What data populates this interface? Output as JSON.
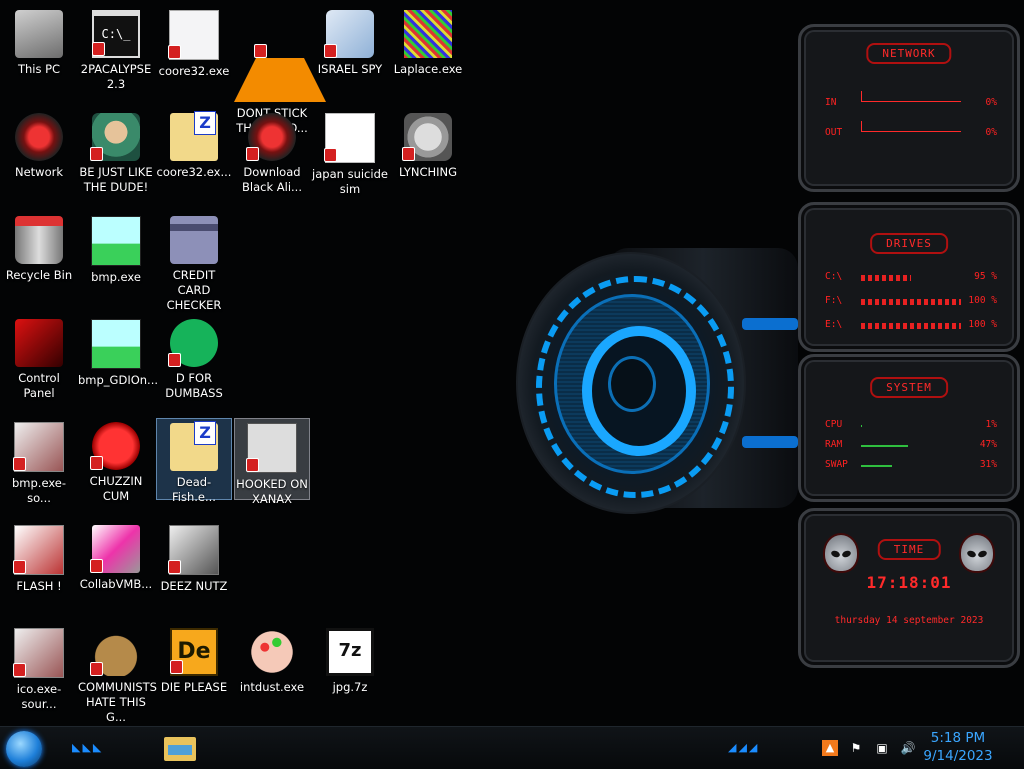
{
  "desktop_icons": [
    {
      "id": "this-pc",
      "label": "This PC",
      "img": "thispc",
      "shield": false
    },
    {
      "id": "2pacalypse",
      "label": "2PACALYPSE 2.3",
      "img": "cmd",
      "glyph": "C:\\_",
      "shield": true
    },
    {
      "id": "coore32-exe",
      "label": "coore32.exe",
      "img": "anime",
      "shield": true
    },
    {
      "id": "dont-stick",
      "label": "DONT STICK THIS IN YO...",
      "img": "vlc",
      "shield": true
    },
    {
      "id": "israel-spy",
      "label": "ISRAEL SPY",
      "img": "israel",
      "shield": true
    },
    {
      "id": "laplace",
      "label": "Laplace.exe",
      "img": "laplace",
      "shield": false
    },
    {
      "id": "network",
      "label": "Network",
      "img": "alien",
      "shield": false
    },
    {
      "id": "be-just-like",
      "label": "BE JUST LIKE THE DUDE!",
      "img": "dude",
      "shield": true
    },
    {
      "id": "coore32-zip",
      "label": "coore32.ex...",
      "img": "zip",
      "shield": false
    },
    {
      "id": "download-black",
      "label": "Download Black Ali...",
      "img": "alien",
      "shield": true
    },
    {
      "id": "japan-suicide",
      "label": "japan suicide sim",
      "img": "japan",
      "shield": true
    },
    {
      "id": "lynching",
      "label": "LYNCHING",
      "img": "lynch",
      "shield": true
    },
    {
      "id": "recycle-bin",
      "label": "Recycle Bin",
      "img": "recycle",
      "shield": false
    },
    {
      "id": "bmp-exe",
      "label": "bmp.exe",
      "img": "bmp",
      "shield": false
    },
    {
      "id": "credit-card",
      "label": "CREDIT CARD CHECKER",
      "img": "credit",
      "shield": false
    },
    {
      "id": "control-panel",
      "label": "Control Panel",
      "img": "cpanel",
      "shield": false
    },
    {
      "id": "bmp-gdi",
      "label": "bmp_GDIOn...",
      "img": "bmp",
      "shield": false
    },
    {
      "id": "d-for-dumbass",
      "label": "D FOR DUMBASS",
      "img": "dfd",
      "shield": true
    },
    {
      "id": "bmp-exe-so",
      "label": "bmp.exe-so...",
      "img": "bmpso",
      "shield": true
    },
    {
      "id": "chuzzin-cum",
      "label": "CHUZZIN CUM",
      "img": "chuzz",
      "shield": true
    },
    {
      "id": "dead-fish",
      "label": "Dead-Fish.e...",
      "img": "zip",
      "shield": false,
      "state": "selected"
    },
    {
      "id": "hooked-on",
      "label": "HOOKED ON XANAX",
      "img": "hooked",
      "shield": true,
      "state": "hover"
    },
    {
      "id": "flash",
      "label": "FLASH !",
      "img": "flash",
      "shield": true
    },
    {
      "id": "collabvmb",
      "label": "CollabVMB...",
      "img": "collab",
      "shield": true
    },
    {
      "id": "deez-nutz",
      "label": "DEEZ NUTZ",
      "img": "deez",
      "shield": true
    },
    {
      "id": "ico-exe-sour",
      "label": "ico.exe-sour...",
      "img": "ico",
      "shield": true
    },
    {
      "id": "communists",
      "label": "COMMUNISTS HATE THIS G...",
      "img": "money",
      "shield": true
    },
    {
      "id": "die-please",
      "label": "DIE PLEASE",
      "img": "die",
      "glyph": "De",
      "shield": true
    },
    {
      "id": "intdust",
      "label": "intdust.exe",
      "img": "paint",
      "shield": false
    },
    {
      "id": "jpg-7z",
      "label": "jpg.7z",
      "img": "7z",
      "glyph": "7z",
      "shield": false
    }
  ],
  "widgets": {
    "network": {
      "title": "NETWORK",
      "rows": [
        {
          "key": "IN",
          "value": "0%"
        },
        {
          "key": "OUT",
          "value": "0%"
        }
      ]
    },
    "drives": {
      "title": "DRIVES",
      "rows": [
        {
          "key": "C:\\",
          "value": "95 %",
          "fill": 0.95
        },
        {
          "key": "F:\\",
          "value": "100 %",
          "fill": 1.0
        },
        {
          "key": "E:\\",
          "value": "100 %",
          "fill": 1.0
        }
      ]
    },
    "system": {
      "title": "SYSTEM",
      "rows": [
        {
          "key": "CPU",
          "value": "1%",
          "fill": 0.01
        },
        {
          "key": "RAM",
          "value": "47%",
          "fill": 0.47
        },
        {
          "key": "SWAP",
          "value": "31%",
          "fill": 0.31
        }
      ]
    },
    "time": {
      "title": "TIME",
      "clock": "17:18:01",
      "date": "thursday 14 september 2023"
    }
  },
  "taskbar": {
    "clock_time": "5:18 PM",
    "clock_date": "9/14/2023",
    "tray_icons": [
      "ai-icon",
      "flag-icon",
      "network-icon",
      "volume-icon"
    ]
  },
  "colors": {
    "hud_red": "#ff2a2a",
    "hud_green": "#2fbf3f",
    "accent_blue": "#1b8cff"
  }
}
